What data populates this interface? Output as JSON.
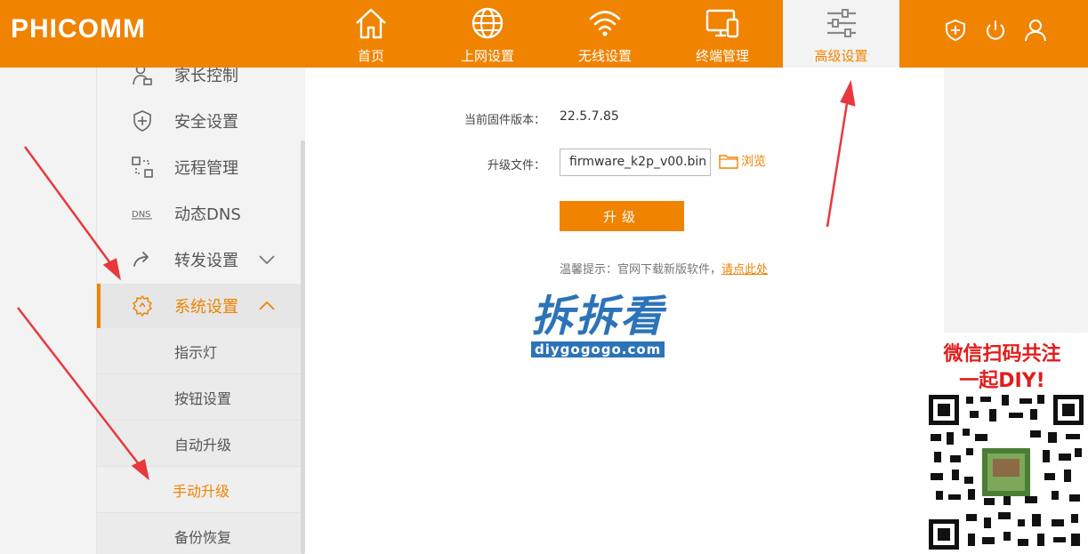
{
  "brand": "PHICOMM",
  "nav": [
    {
      "label": "首页",
      "icon": "home-icon"
    },
    {
      "label": "上网设置",
      "icon": "globe-icon"
    },
    {
      "label": "无线设置",
      "icon": "wifi-icon"
    },
    {
      "label": "终端管理",
      "icon": "devices-icon"
    },
    {
      "label": "高级设置",
      "icon": "sliders-icon",
      "active": true
    }
  ],
  "header_icons": [
    "shield-plus-icon",
    "power-icon",
    "user-icon"
  ],
  "sidebar": {
    "items": [
      {
        "label": "家长控制",
        "icon": "parent-icon"
      },
      {
        "label": "安全设置",
        "icon": "shield-icon"
      },
      {
        "label": "远程管理",
        "icon": "remote-icon"
      },
      {
        "label": "动态DNS",
        "icon": "dns-icon",
        "icon_text": "DNS"
      },
      {
        "label": "转发设置",
        "icon": "forward-icon"
      },
      {
        "label": "系统设置",
        "icon": "gear-icon",
        "active": true
      }
    ],
    "subitems": [
      {
        "label": "指示灯"
      },
      {
        "label": "按钮设置"
      },
      {
        "label": "自动升级"
      },
      {
        "label": "手动升级",
        "active": true
      },
      {
        "label": "备份恢复"
      }
    ]
  },
  "main": {
    "firmware_label": "当前固件版本：",
    "firmware_value": "22.5.7.85",
    "file_label": "升级文件：",
    "file_value": "firmware_k2p_v00.bin",
    "browse_label": "浏览",
    "upgrade_label": "升级",
    "tip_prefix": "温馨提示：官网下载新版软件，",
    "tip_link": "请点此处"
  },
  "watermark": {
    "title": "拆拆看",
    "url": "diygogogo.com"
  },
  "promo": {
    "line1": "微信扫码共注",
    "line2": "一起DIY!"
  },
  "colors": {
    "accent": "#f08300",
    "annotation": "#e8383d",
    "watermark": "#2c73b8"
  }
}
